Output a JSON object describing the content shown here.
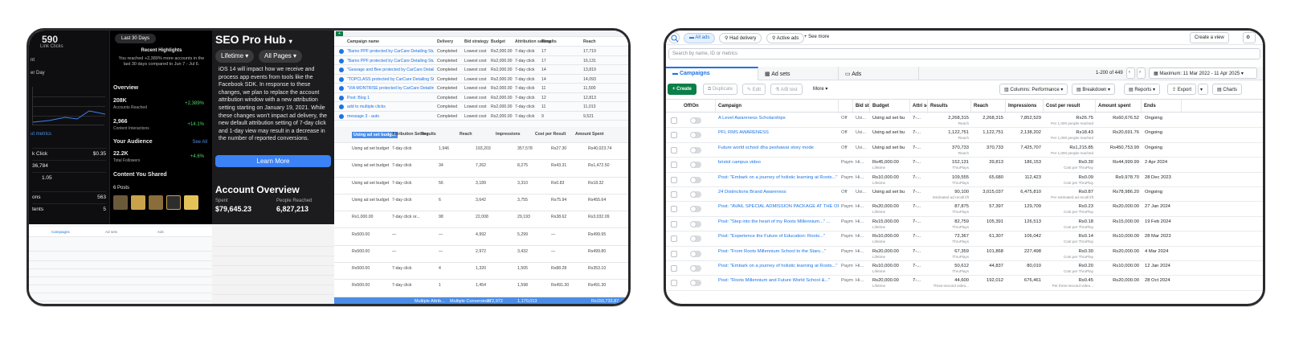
{
  "left_panel": {
    "insights": {
      "link_clicks_value": "590",
      "link_clicks_label": "Link Clicks",
      "date_range": "Last 30 Days",
      "recent_highlights_title": "Recent Highlights",
      "recent_highlights_text": "You reached +2,389% more accounts in the last 30 days compared to Jun 7 - Jul 6.",
      "stub_nt": "nt",
      "stub_per_day": "er Day",
      "stub_metrics": "ut metrics",
      "stat_rows": [
        {
          "label": "k Click",
          "value": "$0.35"
        },
        {
          "label": "36,784",
          "value": ""
        },
        {
          "label": "1.05",
          "value": ""
        }
      ],
      "overview_title": "Overview",
      "accounts_reached_value": "208K",
      "accounts_reached_label": "Accounts Reached",
      "accounts_reached_change": "+2,389%",
      "content_interactions_value": "2,966",
      "content_interactions_label": "Content Interactions",
      "content_interactions_change": "+14.1%",
      "your_audience_title": "Your Audience",
      "see_all": "See All",
      "followers_value": "22.2K",
      "followers_label": "Total Followers",
      "followers_change": "+4.6%",
      "content_shared_title": "Content You Shared",
      "posts_label": "6 Posts",
      "tail_rows": [
        {
          "label": "ons",
          "value": "563"
        },
        {
          "label": "tents",
          "value": "5"
        }
      ]
    },
    "seo_hub": {
      "title": "SEO Pro Hub",
      "lifetime": "Lifetime",
      "all_pages": "All Pages",
      "body": "iOS 14 will impact how we receive and process app events from tools like the Facebook SDK. In response to these changes, we plan to replace the account attribution window with a new attribution setting starting on January 19, 2021. While these changes won't impact ad delivery, the new default attribution setting of 7-day click and 1-day view may result in a decrease in the number of reported conversions.",
      "learn_more": "Learn More",
      "account_overview": "Account Overview",
      "spent_label": "Spent",
      "spent_value": "$79,645.23",
      "reached_label": "People Reached",
      "reached_value": "6,827,213"
    },
    "spreadsheet": {
      "headers": [
        "Campaign name",
        "Delivery",
        "Bid strategy",
        "Budget",
        "Attribution setting",
        "Results",
        "Reach",
        "Impressions",
        "Cost per Result",
        "Amount Spent"
      ],
      "bottom_headers": [
        "Attribution Setting",
        "Results",
        "Reach",
        "Impressions",
        "Cost per Result",
        "Amount Spent"
      ],
      "top_rows": [
        {
          "name": "\"Bamo PPF protected by CarCare Detailing Studio\"",
          "delivery": "Completed",
          "bid": "Lowest cost",
          "budget": "Rs2,000.00",
          "attr": "7-day click",
          "results": "17",
          "reach": "17,719"
        },
        {
          "name": "\"Bamo PPF protected by CarCare Detailing Studio\"",
          "delivery": "Completed",
          "bid": "Lowest cost",
          "budget": "Rs2,000.00",
          "attr": "7-day click",
          "results": "17",
          "reach": "16,131"
        },
        {
          "name": "\"Gearage and Bee protected by CarCare Detailing Studio\"",
          "delivery": "Completed",
          "bid": "Lowest cost",
          "budget": "Rs2,000.00",
          "attr": "7-day click",
          "results": "14",
          "reach": "13,819"
        },
        {
          "name": "\"TOPCLASS protected by CarCare Detailing Studio\"",
          "delivery": "Completed",
          "bid": "Lowest cost",
          "budget": "Rs2,000.00",
          "attr": "7-day click",
          "results": "14",
          "reach": "14,093"
        },
        {
          "name": "\"VIA MONTRISE protected by CarCare Detailing Studio\"",
          "delivery": "Completed",
          "bid": "Lowest cost",
          "budget": "Rs2,000.00",
          "attr": "7-day click",
          "results": "11",
          "reach": "11,500"
        },
        {
          "name": "Post: Blog 1",
          "delivery": "Completed",
          "bid": "Lowest cost",
          "budget": "Rs2,000.00",
          "attr": "7-day click",
          "results": "12",
          "reach": "12,813"
        },
        {
          "name": "add to multiple clicks",
          "delivery": "Completed",
          "bid": "Lowest cost",
          "budget": "Rs2,000.00",
          "attr": "7-day click",
          "results": "11",
          "reach": "11,013"
        },
        {
          "name": "message 3 - auto",
          "delivery": "Completed",
          "bid": "Lowest cost",
          "budget": "Rs2,000.00",
          "attr": "7-day click",
          "results": "9",
          "reach": "9,521"
        }
      ],
      "bottom_rows": [
        {
          "budget": "Using ad set budget",
          "attr": "7-day click",
          "results": "1,946",
          "reach": "193,203",
          "impr": "357,578",
          "cpr": "Rs27.30",
          "spent": "Rs40,023.74"
        },
        {
          "budget": "Using ad set budget",
          "attr": "7-day click",
          "results": "34",
          "reach": "7,262",
          "impr": "8,275",
          "cpr": "Rs43.31",
          "spent": "Rs1,472.50"
        },
        {
          "budget": "Using ad set budget",
          "attr": "7-day click",
          "results": "56",
          "reach": "3,189",
          "impr": "3,310",
          "cpr": "Rs0.83",
          "spent": "Rs18.32"
        },
        {
          "budget": "Using ad set budget",
          "attr": "7-day click",
          "results": "6",
          "reach": "3,642",
          "impr": "3,755",
          "cpr": "Rs75.94",
          "spent": "Rs455.64"
        },
        {
          "budget": "Rs1,000.00",
          "attr": "7-day click or...",
          "results": "98",
          "reach": "22,008",
          "impr": "29,193",
          "cpr": "Rs38.62",
          "spent": "Rs3,032.09"
        },
        {
          "budget": "Rs500.00",
          "attr": "—",
          "results": "—",
          "reach": "4,992",
          "impr": "5,299",
          "cpr": "—",
          "spent": "Rs499.95"
        },
        {
          "budget": "Rs500.00",
          "attr": "—",
          "results": "—",
          "reach": "2,972",
          "impr": "3,432",
          "cpr": "—",
          "spent": "Rs499.80"
        },
        {
          "budget": "Rs500.00",
          "attr": "7-day click",
          "results": "4",
          "reach": "1,320",
          "impr": "1,505",
          "cpr": "Rs88.28",
          "spent": "Rs353.10"
        },
        {
          "budget": "Rs500.00",
          "attr": "7-day click",
          "results": "1",
          "reach": "1,454",
          "impr": "1,598",
          "cpr": "Rs491.30",
          "spent": "Rs491.30"
        }
      ],
      "totals": {
        "results": "Multiple Attrib...",
        "reach": "272,972",
        "impr": "1,170,013",
        "spent": "Rs150,733.87"
      },
      "sel_header": "Using ad set budget",
      "totals_label": "Multiple Conversions"
    }
  },
  "right_panel": {
    "filter_chips": [
      "All ads",
      "Had delivery",
      "Active ads",
      "See more"
    ],
    "create_view": "Create a view",
    "search_placeholder": "Search by name, ID or metrics",
    "tabs": [
      "Campaigns",
      "Ad sets",
      "Ads"
    ],
    "pagination": "1-200 of 449",
    "date_range": "Maximum: 11 Mar 2022 - 11 Apr 2025",
    "toolbar": {
      "create": "Create",
      "duplicate": "Duplicate",
      "edit": "Edit",
      "ab_test": "A/B test",
      "more": "More",
      "columns": "Columns: Performance",
      "breakdown": "Breakdown",
      "reports": "Reports",
      "export": "Export",
      "charts": "Charts"
    },
    "columns": [
      "Off/On",
      "Campaign",
      "",
      "Bid strat",
      "Budget",
      "Attri setti",
      "Results",
      "Reach",
      "Impressions",
      "Cost per result",
      "Amount spent",
      "Ends"
    ],
    "rows": [
      {
        "name": "A Level Awareness Scholarships",
        "state": "Off",
        "bid": "Usi...",
        "budget": "Using ad set bu",
        "attr": "7-...",
        "results": "2,268,315",
        "results_sub": "Reach",
        "reach": "2,268,315",
        "impr": "7,852,529",
        "cost": "Rs26.75",
        "cost_sub": "Per 1,000 people reached",
        "spent": "Rs60,676.52",
        "ends": "Ongoing"
      },
      {
        "name": "PFL RMS AWARENESS",
        "state": "Off",
        "bid": "Usi...",
        "budget": "Using ad set bu",
        "attr": "7-...",
        "results": "1,122,751",
        "results_sub": "Reach",
        "reach": "1,122,751",
        "impr": "2,138,202",
        "cost": "Rs18.43",
        "cost_sub": "Per 1,000 people reached",
        "spent": "Rs20,691.76",
        "ends": "Ongoing"
      },
      {
        "name": "Future world school dha peshawar story mode",
        "state": "Off",
        "bid": "Usi...",
        "budget": "Using ad set bu",
        "attr": "7-...",
        "results": "370,733",
        "results_sub": "Reach",
        "reach": "370,733",
        "impr": "7,425,707",
        "cost": "Rs1,215.85",
        "cost_sub": "Per 1,000 people reached",
        "spent": "Rs450,753.99",
        "ends": "Ongoing"
      },
      {
        "name": "bristol campus video",
        "state": "Paymt",
        "bid": "Hi...",
        "budget": "Rs45,000.00",
        "budget_sub": "Lifetime",
        "attr": "7-...",
        "results": "152,131",
        "results_sub": "ThruPlays",
        "reach": "39,813",
        "impr": "186,153",
        "cost": "Rs0.30",
        "cost_sub": "Cost per ThruPlay",
        "spent": "Rs44,999.99",
        "ends": "2 Apr 2024"
      },
      {
        "name": "Post: \"Embark on a journey of holistic learning at Roots...\"",
        "state": "Paymt",
        "bid": "Hi...",
        "budget": "Rs10,000.00",
        "budget_sub": "Lifetime",
        "attr": "7-...",
        "results": "109,555",
        "results_sub": "ThruPlays",
        "reach": "65,680",
        "impr": "112,423",
        "cost": "Rs0.09",
        "cost_sub": "Cost per ThruPlay",
        "spent": "Rs9,978.70",
        "ends": "28 Dec 2023"
      },
      {
        "name": "24 Distinctions Brand Awareness",
        "state": "Off",
        "bid": "Usi...",
        "budget": "Using ad set bu",
        "attr": "7-...",
        "results": "90,100",
        "results_sub": "Estimated ad recall lift",
        "reach": "3,015,037",
        "impr": "6,475,810",
        "cost": "Rs0.87",
        "cost_sub": "Per estimated ad recall lift",
        "spent": "Rs78,986.20",
        "ends": "Ongoing"
      },
      {
        "name": "Post: \"AVAIL SPECIAL ADMISSION PACKAGE AT THE OPEN...\"",
        "state": "Paymt",
        "bid": "Hi...",
        "budget": "Rs20,000.00",
        "budget_sub": "Lifetime",
        "attr": "7-...",
        "results": "87,875",
        "results_sub": "ThruPlays",
        "reach": "57,397",
        "impr": "129,709",
        "cost": "Rs0.23",
        "cost_sub": "Cost per ThruPlay",
        "spent": "Rs20,000.00",
        "ends": "27 Jan 2024"
      },
      {
        "name": "Post: \"Step into the heart of my Roots Millennium...\" ...",
        "state": "Paymt",
        "bid": "Hi...",
        "budget": "Rs15,000.00",
        "budget_sub": "Lifetime",
        "attr": "7-...",
        "results": "82,759",
        "results_sub": "ThruPlays",
        "reach": "105,391",
        "impr": "126,513",
        "cost": "Rs0.18",
        "cost_sub": "Cost per ThruPlay",
        "spent": "Rs15,000.00",
        "ends": "19 Feb 2024"
      },
      {
        "name": "Post: \"Experience the Future of Education: Roots...\"",
        "state": "Paymt",
        "bid": "Hi...",
        "budget": "Rs10,000.00",
        "budget_sub": "Lifetime",
        "attr": "7-...",
        "results": "72,367",
        "results_sub": "ThruPlays",
        "reach": "61,307",
        "impr": "106,042",
        "cost": "Rs0.14",
        "cost_sub": "Cost per ThruPlay",
        "spent": "Rs10,000.00",
        "ends": "28 Mar 2023"
      },
      {
        "name": "Post: \"From Roots Millennium School to the Stars...\"",
        "state": "Paymt",
        "bid": "Hi...",
        "budget": "Rs20,000.00",
        "budget_sub": "Lifetime",
        "attr": "7-...",
        "results": "67,359",
        "results_sub": "ThruPlays",
        "reach": "101,868",
        "impr": "227,498",
        "cost": "Rs0.30",
        "cost_sub": "Cost per ThruPlay",
        "spent": "Rs20,000.00",
        "ends": "4 Mar 2024"
      },
      {
        "name": "Post: \"Embark on a journey of holistic learning at Roots...\"",
        "state": "Paymt",
        "bid": "Hi...",
        "budget": "Rs10,000.00",
        "budget_sub": "Lifetime",
        "attr": "7-...",
        "results": "50,612",
        "results_sub": "ThruPlays",
        "reach": "44,837",
        "impr": "80,010",
        "cost": "Rs0.20",
        "cost_sub": "Cost per ThruPlay",
        "spent": "Rs10,000.00",
        "ends": "12 Jan 2024"
      },
      {
        "name": "Post: \"Roots Millennium and Future World School &...\"",
        "state": "Paymt",
        "bid": "Hi...",
        "budget": "Rs20,000.00",
        "budget_sub": "Lifetime",
        "attr": "7-...",
        "results": "44,600",
        "results_sub": "Three-second video...",
        "reach": "192,012",
        "impr": "676,461",
        "cost": "Rs0.45",
        "cost_sub": "Per three-second video...",
        "spent": "Rs20,000.00",
        "ends": "28 Oct 2024"
      }
    ]
  },
  "colors": {
    "accent_blue": "#1b74e4",
    "create_green": "#0a7f48",
    "learn_more_blue": "#3b82f6",
    "positive_green": "#4cd964"
  }
}
